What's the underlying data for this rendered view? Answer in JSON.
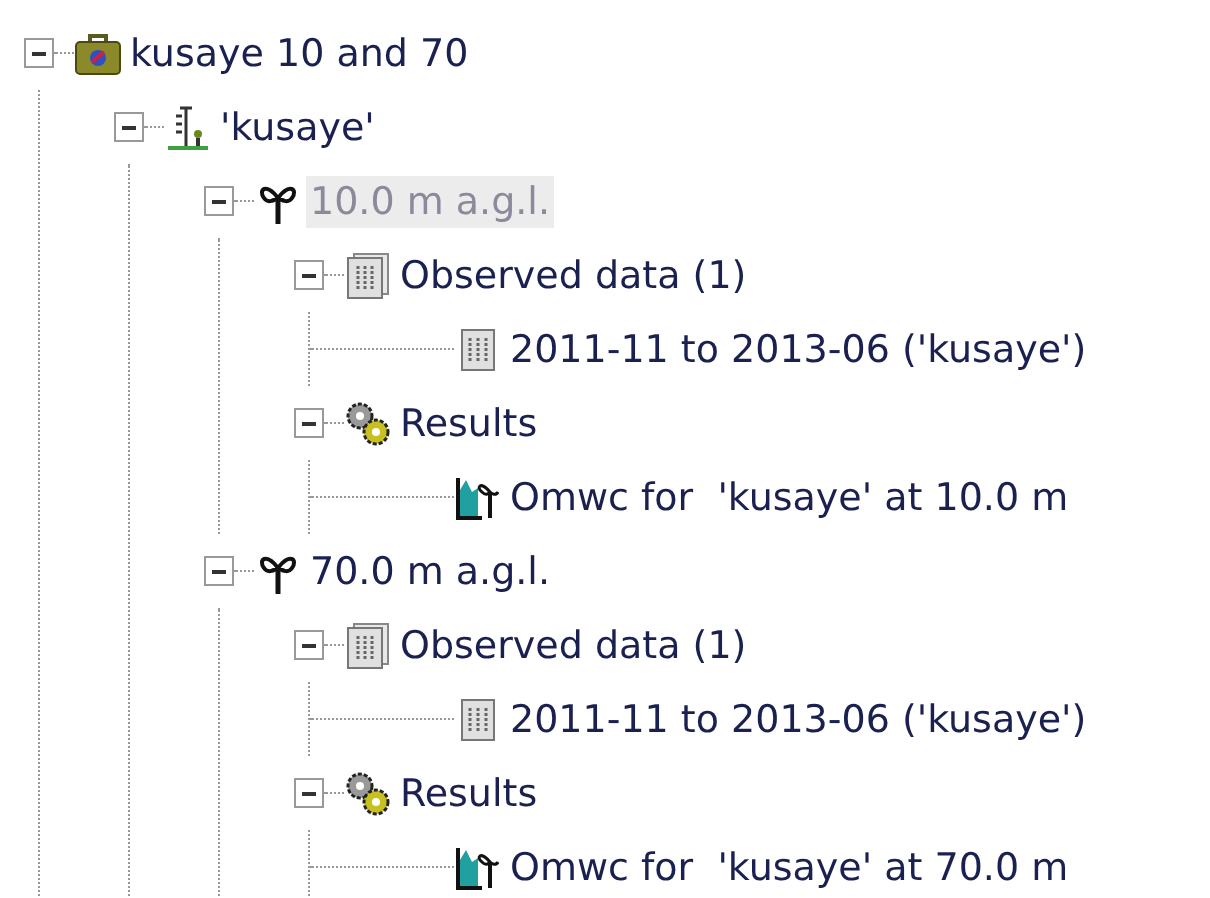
{
  "tree": [
    {
      "label": "kusaye 10 and 70",
      "kind": "project",
      "expanded": true,
      "selected": false,
      "children": [
        {
          "label": "'kusaye'",
          "kind": "site",
          "expanded": true,
          "selected": false,
          "children": [
            {
              "label": "10.0 m a.g.l.",
              "kind": "height",
              "expanded": true,
              "selected": true,
              "children": [
                {
                  "label": "Observed data (1)",
                  "kind": "data",
                  "expanded": true,
                  "selected": false,
                  "children": [
                    {
                      "label": "2011-11 to 2013-06 ('kusaye')",
                      "kind": "series",
                      "selected": false
                    }
                  ]
                },
                {
                  "label": "Results",
                  "kind": "results",
                  "expanded": true,
                  "selected": false,
                  "children": [
                    {
                      "label": "Omwc for  'kusaye' at 10.0 m",
                      "kind": "result",
                      "selected": false
                    }
                  ]
                }
              ]
            },
            {
              "label": "70.0 m a.g.l.",
              "kind": "height",
              "expanded": true,
              "selected": false,
              "children": [
                {
                  "label": "Observed data (1)",
                  "kind": "data",
                  "expanded": true,
                  "selected": false,
                  "children": [
                    {
                      "label": "2011-11 to 2013-06 ('kusaye')",
                      "kind": "series",
                      "selected": false
                    }
                  ]
                },
                {
                  "label": "Results",
                  "kind": "results",
                  "expanded": true,
                  "selected": false,
                  "children": [
                    {
                      "label": "Omwc for  'kusaye' at 70.0 m",
                      "kind": "result",
                      "selected": false
                    }
                  ]
                }
              ]
            }
          ]
        }
      ]
    }
  ]
}
